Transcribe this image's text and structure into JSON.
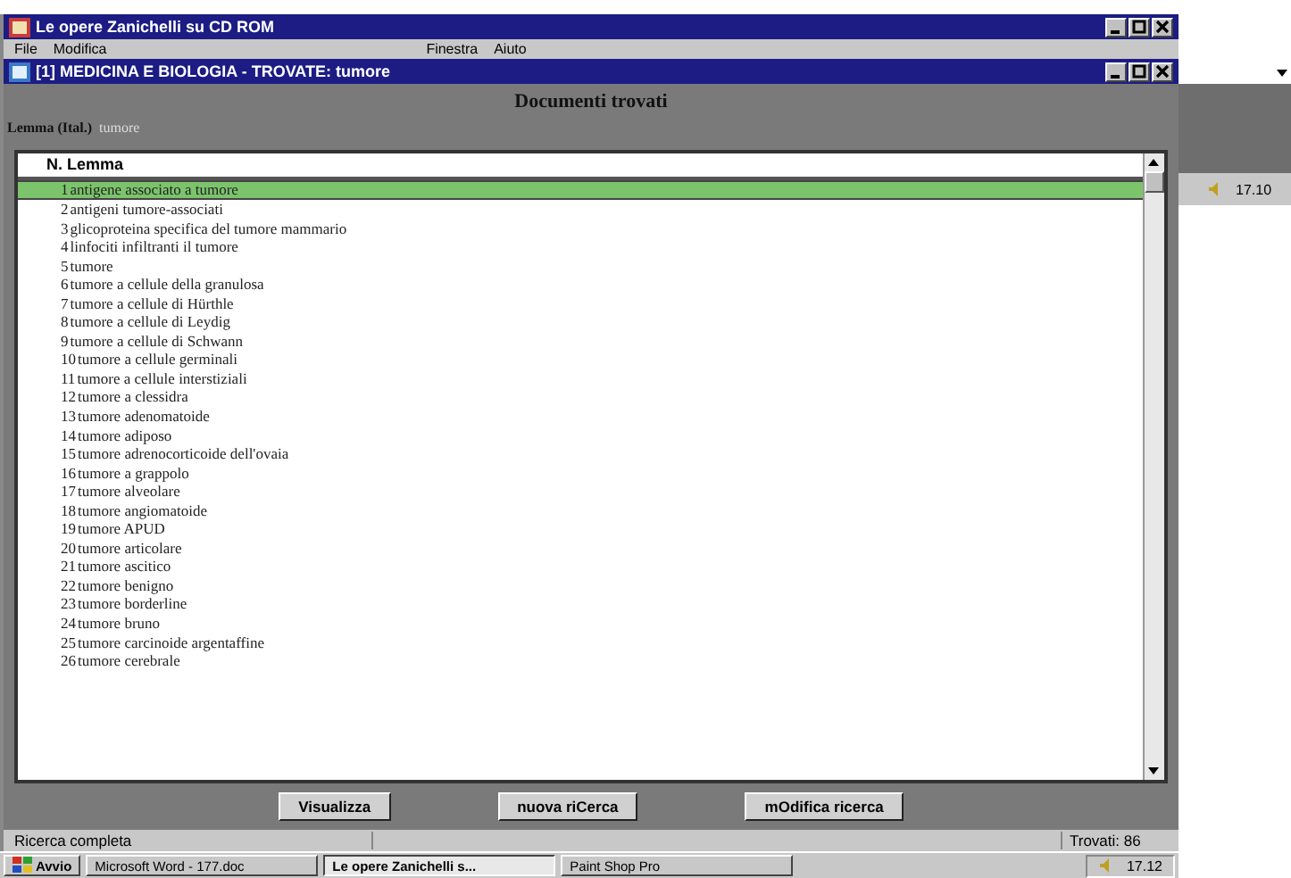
{
  "app_window": {
    "title": "Le opere Zanichelli su CD ROM"
  },
  "menu": [
    "File",
    "Modifica",
    "Finestra",
    "Aiuto"
  ],
  "document_window": {
    "title": "[1] MEDICINA E BIOLOGIA - TROVATE: tumore"
  },
  "panel": {
    "heading": "Documenti trovati",
    "query_label": "Lemma (Ital.)",
    "query_value": "tumore"
  },
  "list": {
    "header": "N. Lemma",
    "rows": [
      {
        "number": "1",
        "text": "antigene associato a tumore",
        "selected": true
      },
      {
        "number": "2",
        "text": "antigeni tumore-associati",
        "selected": false
      },
      {
        "number": "3",
        "text": "glicoproteina specifica del tumore mammario",
        "selected": false
      },
      {
        "number": "4",
        "text": "linfociti infiltranti il tumore",
        "selected": false
      },
      {
        "number": "5",
        "text": "tumore",
        "selected": false
      },
      {
        "number": "6",
        "text": "tumore a cellule della granulosa",
        "selected": false
      },
      {
        "number": "7",
        "text": "tumore a cellule di Hürthle",
        "selected": false
      },
      {
        "number": "8",
        "text": "tumore a cellule di Leydig",
        "selected": false
      },
      {
        "number": "9",
        "text": "tumore a cellule di Schwann",
        "selected": false
      },
      {
        "number": "10",
        "text": "tumore a cellule germinali",
        "selected": false
      },
      {
        "number": "11",
        "text": "tumore a cellule interstiziali",
        "selected": false
      },
      {
        "number": "12",
        "text": "tumore a clessidra",
        "selected": false
      },
      {
        "number": "13",
        "text": "tumore adenomatoide",
        "selected": false
      },
      {
        "number": "14",
        "text": "tumore adiposo",
        "selected": false
      },
      {
        "number": "15",
        "text": "tumore adrenocorticoide dell'ovaia",
        "selected": false
      },
      {
        "number": "16",
        "text": "tumore a grappolo",
        "selected": false
      },
      {
        "number": "17",
        "text": "tumore alveolare",
        "selected": false
      },
      {
        "number": "18",
        "text": "tumore angiomatoide",
        "selected": false
      },
      {
        "number": "19",
        "text": "tumore APUD",
        "selected": false
      },
      {
        "number": "20",
        "text": "tumore articolare",
        "selected": false
      },
      {
        "number": "21",
        "text": "tumore ascitico",
        "selected": false
      },
      {
        "number": "22",
        "text": "tumore benigno",
        "selected": false
      },
      {
        "number": "23",
        "text": "tumore borderline",
        "selected": false
      },
      {
        "number": "24",
        "text": "tumore bruno",
        "selected": false
      },
      {
        "number": "25",
        "text": "tumore carcinoide argentaffine",
        "selected": false
      },
      {
        "number": "26",
        "text": "tumore cerebrale",
        "selected": false
      }
    ]
  },
  "buttons": [
    "Visualizza",
    "nuova riCerca",
    "mOdifica ricerca"
  ],
  "status_bar": {
    "message": "Ricerca completa",
    "count": "Trovati: 86"
  },
  "taskbar": {
    "start": "Avvio",
    "tasks": [
      {
        "label": "Microsoft Word - 177.doc",
        "selected": false
      },
      {
        "label": "Le opere Zanichelli s...",
        "selected": true
      },
      {
        "label": "Paint Shop Pro",
        "selected": false
      }
    ],
    "clock": "17.12"
  },
  "background_tray": {
    "clock": "17.10"
  }
}
